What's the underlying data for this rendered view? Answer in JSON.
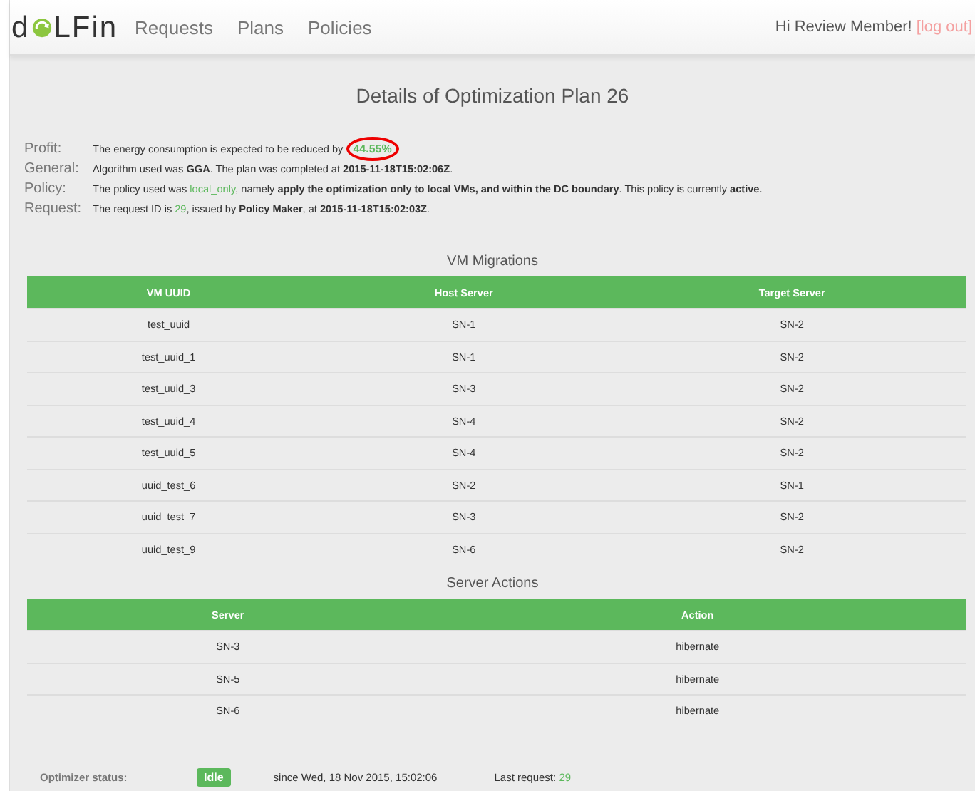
{
  "navbar": {
    "logo": {
      "before": "d",
      "after": "LFin"
    },
    "links": [
      "Requests",
      "Plans",
      "Policies"
    ],
    "greeting": "Hi Review Member!",
    "logout": "[log out]"
  },
  "title": "Details of Optimization Plan 26",
  "details": [
    {
      "label": "Profit:",
      "segments": [
        {
          "kind": "plain",
          "text": "The energy consumption is expected to be reduced by "
        },
        {
          "kind": "circled",
          "text": "44.55%"
        }
      ]
    },
    {
      "label": "General:",
      "segments": [
        {
          "kind": "plain",
          "text": "Algorithm used was "
        },
        {
          "kind": "bold",
          "text": "GGA"
        },
        {
          "kind": "plain",
          "text": ". The plan was completed at "
        },
        {
          "kind": "bold",
          "text": "2015-11-18T15:02:06Z"
        },
        {
          "kind": "plain",
          "text": "."
        }
      ]
    },
    {
      "label": "Policy:",
      "segments": [
        {
          "kind": "plain",
          "text": "The policy used was "
        },
        {
          "kind": "link",
          "text": "local_only"
        },
        {
          "kind": "plain",
          "text": ", namely "
        },
        {
          "kind": "bold",
          "text": "apply the optimization only to local VMs, and within the DC boundary"
        },
        {
          "kind": "plain",
          "text": ". This policy is currently "
        },
        {
          "kind": "bold",
          "text": "active"
        },
        {
          "kind": "plain",
          "text": "."
        }
      ]
    },
    {
      "label": "Request:",
      "segments": [
        {
          "kind": "plain",
          "text": "The request ID is "
        },
        {
          "kind": "link",
          "text": "29"
        },
        {
          "kind": "plain",
          "text": ", issued by "
        },
        {
          "kind": "bold",
          "text": "Policy Maker"
        },
        {
          "kind": "plain",
          "text": ", at "
        },
        {
          "kind": "bold",
          "text": "2015-11-18T15:02:03Z"
        },
        {
          "kind": "plain",
          "text": "."
        }
      ]
    }
  ],
  "tables": [
    {
      "title": "VM Migrations",
      "columns": [
        "VM UUID",
        "Host Server",
        "Target Server"
      ],
      "rows": [
        [
          "test_uuid",
          "SN-1",
          "SN-2"
        ],
        [
          "test_uuid_1",
          "SN-1",
          "SN-2"
        ],
        [
          "test_uuid_3",
          "SN-3",
          "SN-2"
        ],
        [
          "test_uuid_4",
          "SN-4",
          "SN-2"
        ],
        [
          "test_uuid_5",
          "SN-4",
          "SN-2"
        ],
        [
          "uuid_test_6",
          "SN-2",
          "SN-1"
        ],
        [
          "uuid_test_7",
          "SN-3",
          "SN-2"
        ],
        [
          "uuid_test_9",
          "SN-6",
          "SN-2"
        ]
      ]
    },
    {
      "title": "Server Actions",
      "columns": [
        "Server",
        "Action"
      ],
      "rows": [
        [
          "SN-3",
          "hibernate"
        ],
        [
          "SN-5",
          "hibernate"
        ],
        [
          "SN-6",
          "hibernate"
        ]
      ]
    }
  ],
  "status_bar": {
    "label": "Optimizer status:",
    "status": "Idle",
    "since": "since Wed, 18 Nov 2015, 15:02:06",
    "last_label": "Last request: ",
    "last_value": "29"
  }
}
